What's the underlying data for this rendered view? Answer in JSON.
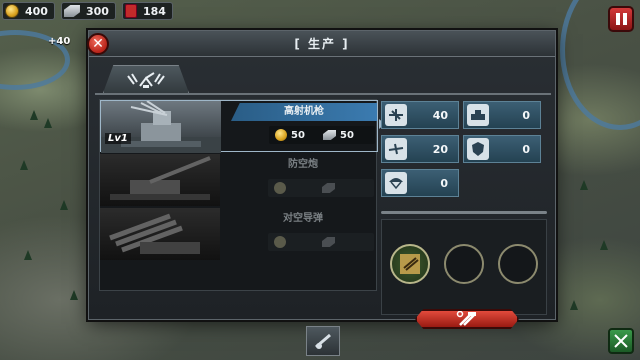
{
  "topbar": {
    "gold": "400",
    "steel": "300",
    "medals": "184"
  },
  "map": {
    "income_label": "+40"
  },
  "dialog": {
    "title": "[ 生产 ]",
    "close_icon": "close-icon",
    "category_tab_icon": "anti-air-gun-icon",
    "units": [
      {
        "name": "高射机枪",
        "level": "Lv1",
        "gold_cost": "50",
        "steel_cost": "50",
        "state": "selected"
      },
      {
        "name": "防空炮",
        "level": "",
        "gold_cost": "",
        "steel_cost": "",
        "state": "locked"
      },
      {
        "name": "对空导弹",
        "level": "",
        "gold_cost": "",
        "steel_cost": "",
        "state": "locked"
      }
    ],
    "stats": [
      {
        "icon": "vs-aircraft-icon",
        "value": "40"
      },
      {
        "icon": "vs-armor-icon",
        "value": "0"
      },
      {
        "icon": "vs-airplane-icon",
        "value": "20"
      },
      {
        "icon": "vs-shield-icon",
        "value": "0"
      },
      {
        "icon": "vs-paratrooper-icon",
        "value": "0"
      }
    ],
    "build_button_icon": "hammer-wrench-icon",
    "queue_slots": [
      "filled",
      "empty",
      "empty"
    ]
  },
  "colors": {
    "accent_blue": "#3b7bb0",
    "build_red": "#e24a3c",
    "stat_bg": "#244252"
  }
}
